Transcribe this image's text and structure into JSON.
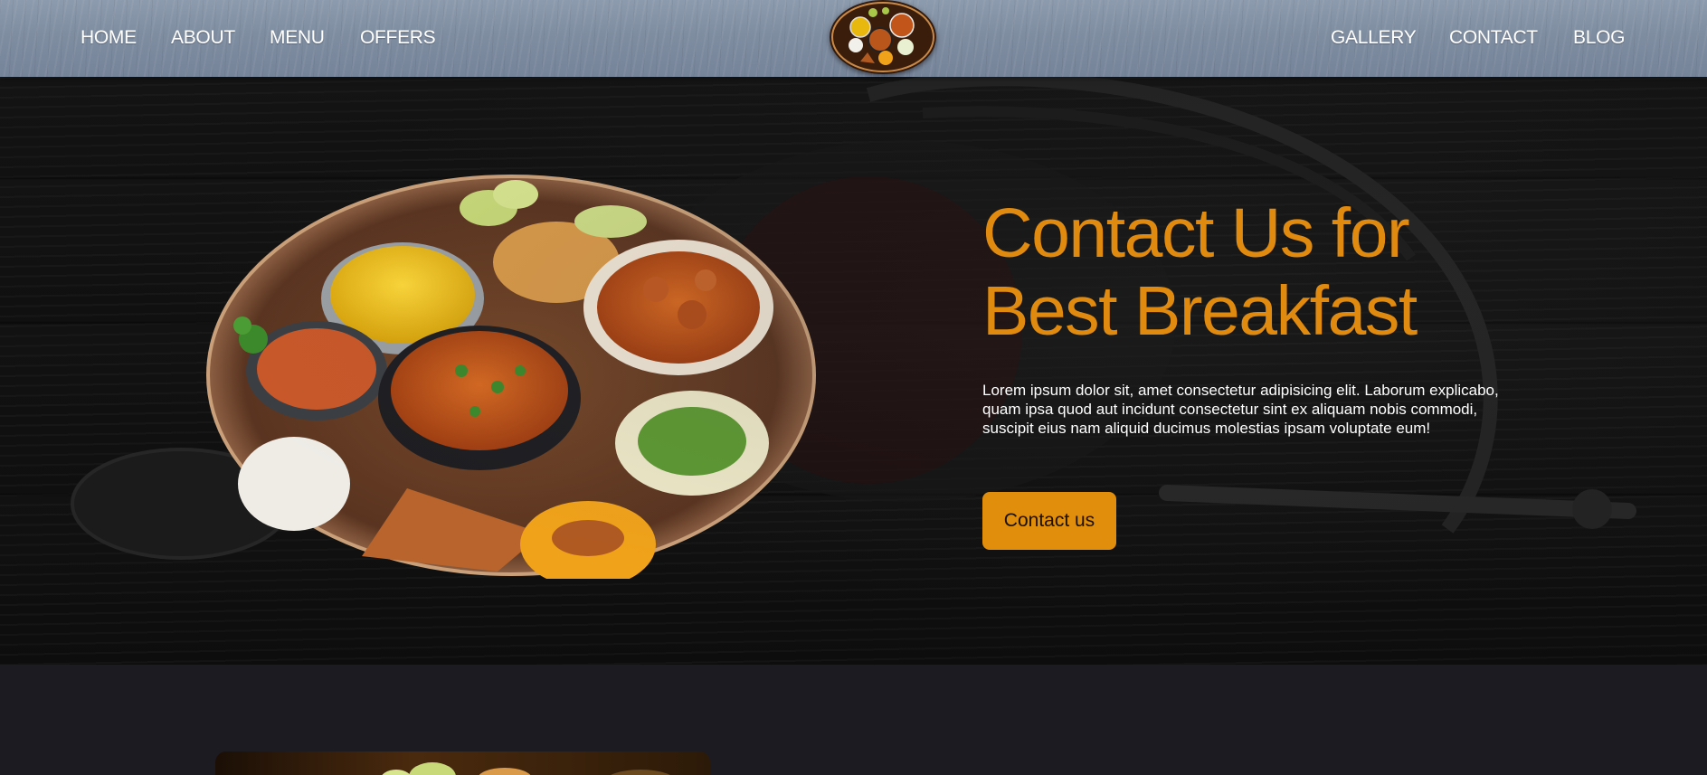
{
  "nav": {
    "left_links": [
      "HOME",
      "ABOUT",
      "MENU",
      "OFFERS"
    ],
    "right_links": [
      "GALLERY",
      "CONTACT",
      "BLOG"
    ]
  },
  "hero": {
    "title_line1": "Contact Us for",
    "title_line2": "Best Breakfast",
    "description": "Lorem ipsum dolor sit, amet consectetur adipisicing elit. Laborum explicabo, quam ipsa quod aut incidunt consectetur sint ex aliquam nobis commodi, suscipit eius nam aliquid ducimus molestias ipsam voluptate eum!",
    "button_label": "Contact us"
  },
  "colors": {
    "accent": "#e08a10",
    "nav_bg": "#8391a5",
    "page_bg": "#1c1b21"
  }
}
